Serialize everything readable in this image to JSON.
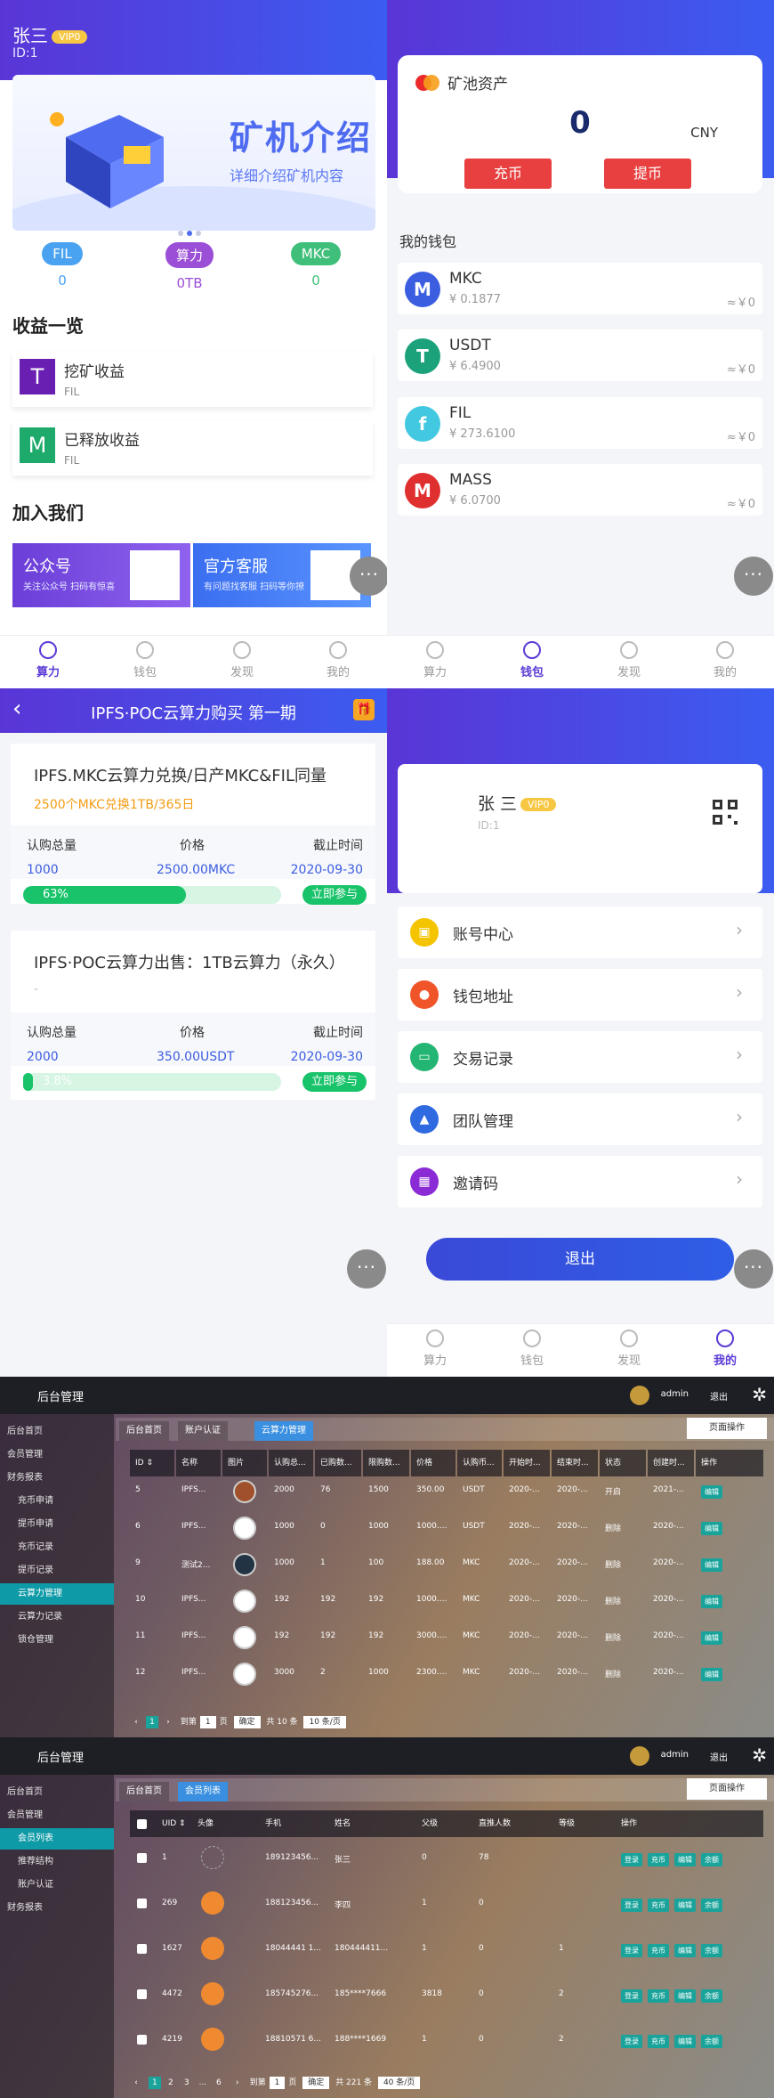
{
  "home": {
    "user_name": "张三",
    "vip": "VIP0",
    "uid": "ID:1",
    "banner_title": "矿机介绍",
    "banner_sub": "详细介绍矿机内容",
    "stats": [
      {
        "label": "FIL",
        "value": "0",
        "color": "#4aa3f0"
      },
      {
        "label": "算力",
        "value": "0TB",
        "color": "#9b4fd6"
      },
      {
        "label": "MKC",
        "value": "0",
        "color": "#3fbf7a"
      }
    ],
    "earn_title": "收益一览",
    "earnings": [
      {
        "icon": "T",
        "name": "挖矿收益",
        "sub": "FIL",
        "color": "#6a1fb3"
      },
      {
        "icon": "M",
        "name": "已释放收益",
        "sub": "FIL",
        "color": "#1daa6a"
      }
    ],
    "join_title": "加入我们",
    "join": [
      {
        "title": "公众号",
        "sub": "关注公众号 扫码有惊喜"
      },
      {
        "title": "官方客服",
        "sub": "有问题找客服 扫码等你撩"
      }
    ]
  },
  "tabs": [
    "算力",
    "钱包",
    "发现",
    "我的"
  ],
  "wallet": {
    "asset_title": "矿池资产",
    "asset_value": "0",
    "currency": "CNY",
    "deposit": "充币",
    "withdraw": "提币",
    "my_wallet": "我的钱包",
    "coins": [
      {
        "name": "MKC",
        "value": "¥ 0.1877",
        "approx": "≈￥0",
        "color": "#3b5de0",
        "icon": "M"
      },
      {
        "name": "USDT",
        "value": "¥ 6.4900",
        "approx": "≈￥0",
        "color": "#1ba27a",
        "icon": "T"
      },
      {
        "name": "FIL",
        "value": "¥ 273.6100",
        "approx": "≈￥0",
        "color": "#42c8e0",
        "icon": "f"
      },
      {
        "name": "MASS",
        "value": "¥ 6.0700",
        "approx": "≈￥0",
        "color": "#e02f2f",
        "icon": "M"
      }
    ]
  },
  "purchase": {
    "title": "IPFS·POC云算力购买 第一期",
    "back": "‹",
    "gift": "🎁",
    "labels": {
      "total": "认购总量",
      "price": "价格",
      "deadline": "截止时间"
    },
    "join_label": "立即参与",
    "cards": [
      {
        "title": "IPFS.MKC云算力兑换/日产MKC&FIL同量",
        "sub": "2500个MKC兑换1TB/365日",
        "total": "1000",
        "price": "2500.00MKC",
        "deadline": "2020-09-30",
        "progress": "63%",
        "progress_value": 63
      },
      {
        "title": "IPFS·POC云算力出售：1TB云算力（永久）",
        "sub": "-",
        "total": "2000",
        "price": "350.00USDT",
        "deadline": "2020-09-30",
        "progress": "3.8%",
        "progress_value": 3.8
      }
    ]
  },
  "mine": {
    "user_name": "张 三",
    "vip": "VIP0",
    "uid": "ID:1",
    "logout": "退出",
    "menu": [
      {
        "label": "账号中心",
        "color": "#f5c400"
      },
      {
        "label": "钱包地址",
        "color": "#f0552a"
      },
      {
        "label": "交易记录",
        "color": "#22b573"
      },
      {
        "label": "团队管理",
        "color": "#2f6ae0"
      },
      {
        "label": "邀请码",
        "color": "#8a2bd6"
      }
    ]
  },
  "admin1": {
    "logo": "后台管理",
    "admin": "admin",
    "exit": "退出",
    "page_op": "页面操作",
    "nav": [
      "后台首页",
      "会员管理",
      "财务报表",
      "充币申请",
      "提币申请",
      "充币记录",
      "提币记录",
      "云算力管理",
      "云算力记录",
      "锁仓管理"
    ],
    "tabs": [
      "后台首页",
      "账户认证",
      "云算力管理"
    ],
    "headers": [
      "ID ⇕",
      "名称",
      "图片",
      "认购总...",
      "已购数...",
      "限购数...",
      "价格",
      "认购币...",
      "开始时...",
      "结束时...",
      "状态",
      "创建时...",
      "操作"
    ],
    "rows": [
      [
        "5",
        "IPFS...",
        "",
        "2000",
        "76",
        "1500",
        "350.00",
        "USDT",
        "2020-...",
        "2020-...",
        "开启",
        "2021-..."
      ],
      [
        "6",
        "IPFS...",
        "",
        "1000",
        "0",
        "1000",
        "1000....",
        "USDT",
        "2020-...",
        "2020-...",
        "删除",
        "2020-..."
      ],
      [
        "9",
        "测试2...",
        "",
        "1000",
        "1",
        "100",
        "188.00",
        "MKC",
        "2020-...",
        "2020-...",
        "删除",
        "2020-..."
      ],
      [
        "10",
        "IPFS...",
        "",
        "192",
        "192",
        "192",
        "1000....",
        "MKC",
        "2020-...",
        "2020-...",
        "删除",
        "2020-..."
      ],
      [
        "11",
        "IPFS...",
        "",
        "192",
        "192",
        "192",
        "3000....",
        "MKC",
        "2020-...",
        "2020-...",
        "删除",
        "2020-..."
      ],
      [
        "12",
        "IPFS...",
        "",
        "3000",
        "2",
        "1000",
        "2300....",
        "MKC",
        "2020-...",
        "2020-...",
        "删除",
        "2020-..."
      ]
    ],
    "op": "编辑",
    "pager": {
      "page": "1",
      "goto": "到第",
      "page_unit": "页",
      "confirm": "确定",
      "total": "共 10 条",
      "per": "10 条/页"
    }
  },
  "admin2": {
    "logo": "后台管理",
    "admin": "admin",
    "exit": "退出",
    "page_op": "页面操作",
    "nav": [
      "后台首页",
      "会员管理",
      "会员列表",
      "推荐结构",
      "账户认证",
      "财务报表"
    ],
    "tabs": [
      "后台首页",
      "会员列表"
    ],
    "headers": [
      "UID ⇕",
      "头像",
      "手机",
      "姓名",
      "父级",
      "直推人数",
      "等级",
      "操作"
    ],
    "rows": [
      [
        "1",
        "",
        "18912345​6...",
        "张三",
        "0",
        "78",
        ""
      ],
      [
        "269",
        "",
        "18812345​6...",
        "李四",
        "1",
        "0",
        ""
      ],
      [
        "1627",
        "",
        "18044441 1...",
        "180444411...",
        "1",
        "0",
        "1"
      ],
      [
        "4472",
        "",
        "18574527​6...",
        "185****7666",
        "3818",
        "0",
        "2"
      ],
      [
        "4219",
        "",
        "18810571 6...",
        "188****1669",
        "1",
        "0",
        "2"
      ]
    ],
    "ops": [
      "登录",
      "充币",
      "编辑",
      "余额"
    ],
    "pager": {
      "pages": [
        "1",
        "2",
        "3",
        "...",
        "6"
      ],
      "goto": "到第",
      "page": "1",
      "page_unit": "页",
      "confirm": "确定",
      "total": "共 221 条",
      "per": "40 条/页"
    }
  }
}
